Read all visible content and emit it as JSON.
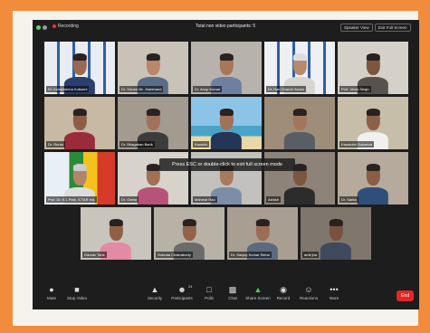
{
  "window": {
    "recording": "Recording",
    "title": "Total non video participants: 5",
    "speaker_view": "Speaker View",
    "exit_full_screen": "Exit Full Screen"
  },
  "notice": "Press ESC or double-click to exit full screen mode",
  "participants": [
    "Dr. Indrajitsinha Kulkarni",
    "Dr. Sriram Mr. Jharkhand",
    "Dr. Anup Kumar",
    "Dr. Hari Chandi Harish",
    "Prof. Vivek Singh",
    "Dr. Runta",
    "Dr. Bhagaban Barik",
    "Kaushik",
    "",
    "Kaustubh Sukumar",
    "Prof. Dr. K L Patil, ICTAR Ind.",
    "Dr. Geeta",
    "Mahesh Rao",
    "Ashish",
    "Dr. Sarita",
    "Gaurav Tank",
    "Subrata Chakraborty",
    "Dr. Sanjay Kumar Sinha",
    "amit jha"
  ],
  "controls": {
    "mute": "Mute",
    "stop_video": "Stop Video",
    "security": "Security",
    "participants": "Participants",
    "participants_count": "24",
    "polls": "Polls",
    "chat": "Chat",
    "share_screen": "Share Screen",
    "record": "Record",
    "reactions": "Reactions",
    "more": "More",
    "end": "End"
  },
  "colors": {
    "frame": "#f08c3c",
    "active_speaker": "#b8d53a",
    "end_button": "#e02828"
  }
}
